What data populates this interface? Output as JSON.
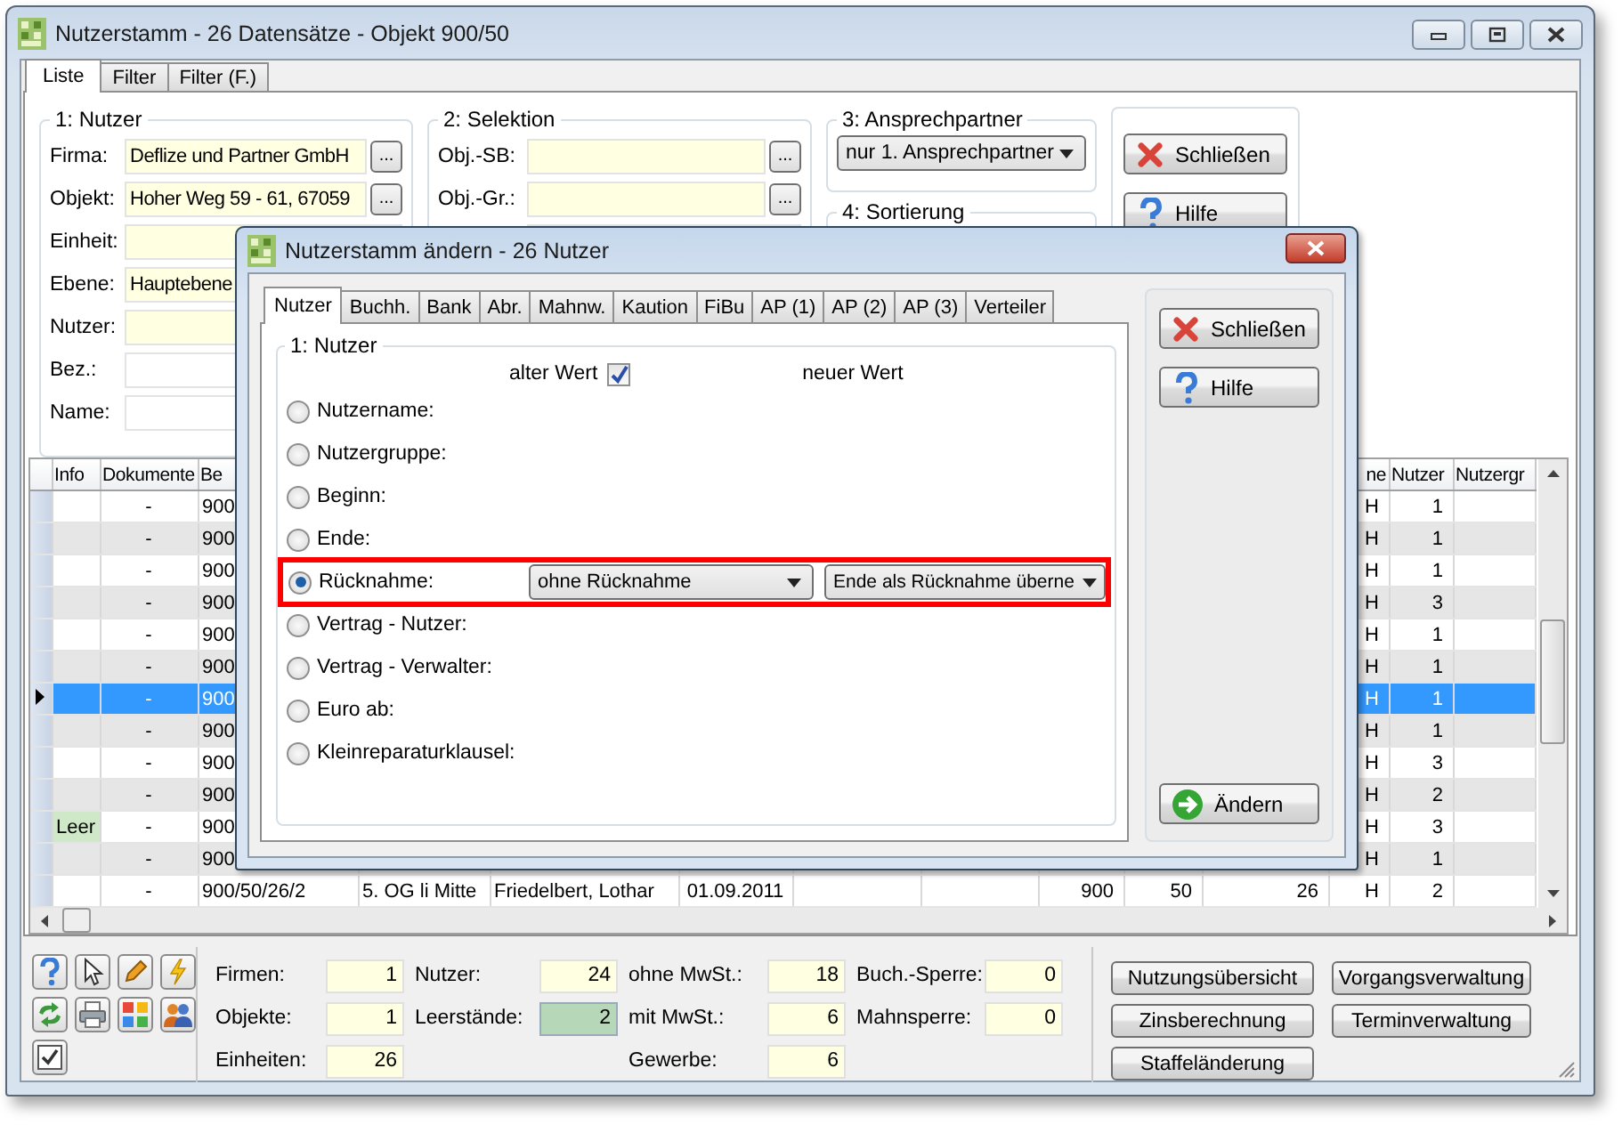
{
  "window": {
    "title": "Nutzerstamm - 26 Datensätze - Objekt 900/50"
  },
  "tabs": [
    {
      "label": "Liste",
      "selected": true
    },
    {
      "label": "Filter",
      "selected": false
    },
    {
      "label": "Filter (F.)",
      "selected": false
    }
  ],
  "nutzer_group": {
    "title": "1: Nutzer",
    "fields": [
      {
        "label": "Firma:",
        "value": "Deflize und Partner GmbH",
        "kind": "lookup",
        "button": "..."
      },
      {
        "label": "Objekt:",
        "value": "Hoher Weg 59 - 61, 67059",
        "kind": "lookup",
        "button": "..."
      },
      {
        "label": "Einheit:",
        "kind": "input"
      },
      {
        "label": "Ebene:",
        "value": "Hauptebene",
        "kind": "input"
      },
      {
        "label": "Nutzer:",
        "kind": "input"
      },
      {
        "label": "Bez.:",
        "kind": "plain"
      },
      {
        "label": "Name:",
        "kind": "plain"
      }
    ]
  },
  "selektion_group": {
    "title": "2: Selektion",
    "fields": [
      {
        "label": "Obj.-SB:",
        "kind": "lookup",
        "button": "..."
      },
      {
        "label": "Obj.-Gr.:",
        "kind": "lookup",
        "button": "..."
      },
      {
        "kind": "input"
      }
    ]
  },
  "ansprechpartner_group": {
    "title": "3: Ansprechpartner",
    "value": "nur 1. Ansprechpartner"
  },
  "sortierung_group": {
    "title": "4: Sortierung"
  },
  "main_buttons": [
    {
      "label": "Schließen",
      "kind": "close"
    },
    {
      "label": "Hilfe",
      "kind": "help"
    }
  ],
  "grid": {
    "header": {
      "info": "Info",
      "dokumente": "Dokumente",
      "col_3": "Be",
      "col_12": "ne",
      "nutzer": "Nutzer",
      "col_14": "Nutzergr"
    },
    "rows": [
      {
        "dokumente": "-",
        "col_3": "900",
        "col_12": "H",
        "nutzer": "1",
        "selected": false,
        "vacant": false
      },
      {
        "dokumente": "-",
        "col_3": "900",
        "col_12": "H",
        "nutzer": "1",
        "selected": false,
        "vacant": false
      },
      {
        "dokumente": "-",
        "col_3": "900",
        "col_12": "H",
        "nutzer": "1",
        "selected": false,
        "vacant": false
      },
      {
        "dokumente": "-",
        "col_3": "900",
        "col_12": "H",
        "nutzer": "3",
        "selected": false,
        "vacant": false
      },
      {
        "dokumente": "-",
        "col_3": "900",
        "col_12": "H",
        "nutzer": "1",
        "selected": false,
        "vacant": false
      },
      {
        "dokumente": "-",
        "col_3": "900",
        "col_12": "H",
        "nutzer": "1",
        "selected": false,
        "vacant": false
      },
      {
        "dokumente": "-",
        "col_3": "900",
        "col_12": "H",
        "nutzer": "1",
        "selected": true,
        "vacant": false
      },
      {
        "dokumente": "-",
        "col_3": "900",
        "col_12": "H",
        "nutzer": "1",
        "selected": false,
        "vacant": false
      },
      {
        "dokumente": "-",
        "col_3": "900",
        "col_12": "H",
        "nutzer": "3",
        "selected": false,
        "vacant": false
      },
      {
        "dokumente": "-",
        "col_3": "900",
        "col_12": "H",
        "nutzer": "2",
        "selected": false,
        "vacant": false
      },
      {
        "info": "Leer",
        "dokumente": "-",
        "col_3": "900",
        "col_12": "H",
        "nutzer": "3",
        "selected": false,
        "vacant": true
      },
      {
        "dokumente": "-",
        "col_3": "900",
        "col_12": "H",
        "nutzer": "1",
        "selected": false,
        "vacant": false
      },
      {
        "dokumente": "-",
        "col_3": "900/50/26/2",
        "col_4": "5. OG li Mitte",
        "col_5": "Friedelbert, Lothar",
        "col_6": "01.09.2011",
        "col_9": "900",
        "col_10": "50",
        "col_11": "26",
        "col_12": "H",
        "nutzer": "2",
        "selected": false,
        "vacant": false
      }
    ]
  },
  "toolbar": [
    {
      "kind": "help"
    },
    {
      "kind": "pointer"
    },
    {
      "kind": "pencil"
    },
    {
      "kind": "lightning"
    },
    {
      "kind": "refresh"
    },
    {
      "kind": "print"
    },
    {
      "kind": "tiles"
    },
    {
      "kind": "people"
    },
    {
      "kind": "checkbox"
    }
  ],
  "stats": [
    [
      {
        "label": "Firmen:",
        "value": "1",
        "highlighted": false
      },
      {
        "label": "Objekte:",
        "value": "1",
        "highlighted": false
      },
      {
        "label": "Einheiten:",
        "value": "26",
        "highlighted": false
      }
    ],
    [
      {
        "label": "Nutzer:",
        "value": "24",
        "highlighted": false
      },
      {
        "label": "Leerstände:",
        "value": "2",
        "highlighted": true
      }
    ],
    [
      {
        "label": "ohne MwSt.:",
        "value": "18",
        "highlighted": false
      },
      {
        "label": "mit MwSt.:",
        "value": "6",
        "highlighted": false
      },
      {
        "label": "Gewerbe:",
        "value": "6",
        "highlighted": false
      }
    ],
    [
      {
        "label": "Buch.-Sperre:",
        "value": "0",
        "highlighted": false
      },
      {
        "label": "Mahnsperre:",
        "value": "0",
        "highlighted": false
      }
    ]
  ],
  "actions": [
    "Nutzungsübersicht",
    "Vorgangsverwaltung",
    "Zinsberechnung",
    "Terminverwaltung",
    "Staffeländerung"
  ],
  "dialog": {
    "title": "Nutzerstamm ändern - 26 Nutzer",
    "tabs": [
      {
        "label": "Nutzer",
        "selected": true
      },
      {
        "label": "Buchh.",
        "selected": false
      },
      {
        "label": "Bank",
        "selected": false
      },
      {
        "label": "Abr.",
        "selected": false
      },
      {
        "label": "Mahnw.",
        "selected": false
      },
      {
        "label": "Kaution",
        "selected": false
      },
      {
        "label": "FiBu",
        "selected": false
      },
      {
        "label": "AP (1)",
        "selected": false
      },
      {
        "label": "AP (2)",
        "selected": false
      },
      {
        "label": "AP (3)",
        "selected": false
      },
      {
        "label": "Verteiler",
        "selected": false
      }
    ],
    "group": {
      "title": "1: Nutzer",
      "old_label": "alter Wert",
      "old_checked": true,
      "new_label": "neuer Wert",
      "options": [
        {
          "label": "Nutzername:",
          "selected": false,
          "highlighted": false
        },
        {
          "label": "Nutzergruppe:",
          "selected": false,
          "highlighted": false
        },
        {
          "label": "Beginn:",
          "selected": false,
          "highlighted": false
        },
        {
          "label": "Ende:",
          "selected": false,
          "highlighted": false
        },
        {
          "label": "Rücknahme:",
          "selected": true,
          "highlighted": true,
          "choices": [
            "ohne Rücknahme",
            "Ende als Rücknahme überne"
          ]
        },
        {
          "label": "Vertrag - Nutzer:",
          "selected": false,
          "highlighted": false
        },
        {
          "label": "Vertrag - Verwalter:",
          "selected": false,
          "highlighted": false
        },
        {
          "label": "Euro ab:",
          "selected": false,
          "highlighted": false
        },
        {
          "label": "Kleinreparaturklausel:",
          "selected": false,
          "highlighted": false
        }
      ]
    },
    "buttons": [
      {
        "label": "Schließen",
        "kind": "close"
      },
      {
        "label": "Hilfe",
        "kind": "help"
      },
      {
        "label": "Ändern",
        "kind": "apply"
      }
    ]
  }
}
